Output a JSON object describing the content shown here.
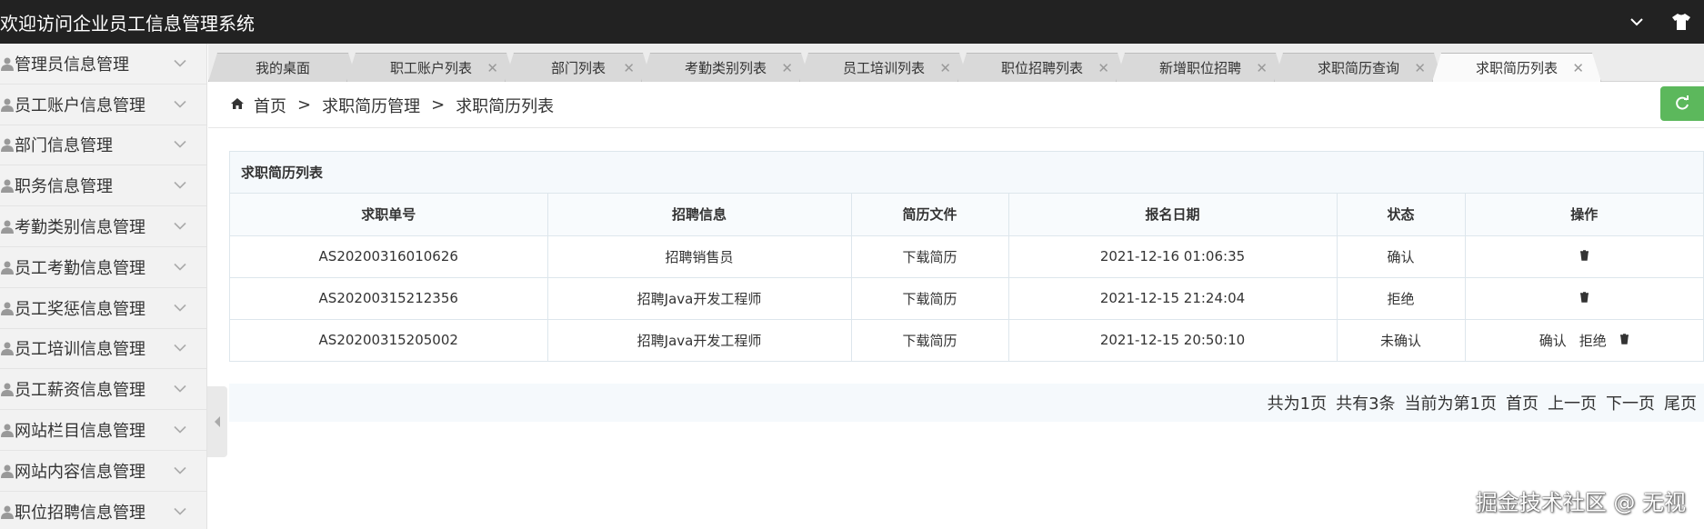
{
  "app": {
    "title": "欢迎访问企业员工信息管理系统"
  },
  "sidebar": {
    "items": [
      {
        "label": "管理员信息管理"
      },
      {
        "label": "员工账户信息管理"
      },
      {
        "label": "部门信息管理"
      },
      {
        "label": "职务信息管理"
      },
      {
        "label": "考勤类别信息管理"
      },
      {
        "label": "员工考勤信息管理"
      },
      {
        "label": "员工奖惩信息管理"
      },
      {
        "label": "员工培训信息管理"
      },
      {
        "label": "员工薪资信息管理"
      },
      {
        "label": "网站栏目信息管理"
      },
      {
        "label": "网站内容信息管理"
      },
      {
        "label": "职位招聘信息管理"
      }
    ]
  },
  "tabs": [
    {
      "label": "我的桌面",
      "closable": false
    },
    {
      "label": "职工账户列表",
      "closable": true
    },
    {
      "label": "部门列表",
      "closable": true
    },
    {
      "label": "考勤类别列表",
      "closable": true
    },
    {
      "label": "员工培训列表",
      "closable": true
    },
    {
      "label": "职位招聘列表",
      "closable": true
    },
    {
      "label": "新增职位招聘",
      "closable": true
    },
    {
      "label": "求职简历查询",
      "closable": true
    },
    {
      "label": "求职简历列表",
      "closable": true,
      "active": true
    }
  ],
  "breadcrumb": {
    "home": "首页",
    "sep": ">",
    "level1": "求职简历管理",
    "level2": "求职简历列表"
  },
  "panel": {
    "title": "求职简历列表"
  },
  "table": {
    "headers": [
      "求职单号",
      "招聘信息",
      "简历文件",
      "报名日期",
      "状态",
      "操作"
    ],
    "rows": [
      {
        "id": "AS20200316010626",
        "job": "招聘销售员",
        "file": "下载简历",
        "date": "2021-12-16 01:06:35",
        "status": "确认"
      },
      {
        "id": "AS20200315212356",
        "job": "招聘Java开发工程师",
        "file": "下载简历",
        "date": "2021-12-15 21:24:04",
        "status": "拒绝"
      },
      {
        "id": "AS20200315205002",
        "job": "招聘Java开发工程师",
        "file": "下载简历",
        "date": "2021-12-15 20:50:10",
        "status": "未确认"
      }
    ],
    "actions": {
      "confirm": "确认",
      "reject": "拒绝"
    }
  },
  "pager": {
    "total_pages": "共为1页",
    "total_items": "共有3条",
    "current": "当前为第1页",
    "first": "首页",
    "prev": "上一页",
    "next": "下一页",
    "last": "尾页"
  },
  "watermark": "掘金技术社区 @ 无视",
  "colors": {
    "topbar": "#222222",
    "refresh": "#5cb85c"
  }
}
